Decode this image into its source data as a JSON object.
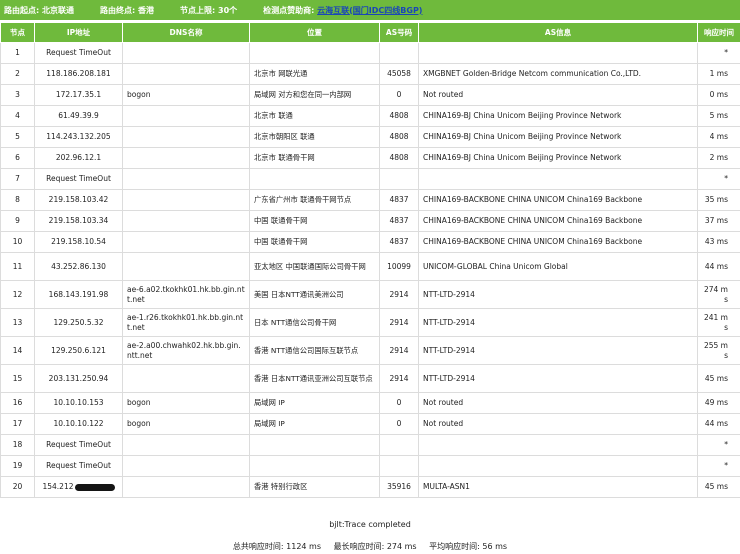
{
  "header": {
    "start_label": "路由起点:",
    "start_value": "北京联通",
    "end_label": "路由终点:",
    "end_value": "香港",
    "hop_limit_label": "节点上限:",
    "hop_limit_value": "30个",
    "sponsor_label": "检测点赞助商:",
    "sponsor_name": "云海互联",
    "sponsor_link": "(国门IDC四线BGP)"
  },
  "columns": [
    "节点",
    "IP地址",
    "DNS名称",
    "位置",
    "AS号码",
    "AS信息",
    "响应时间"
  ],
  "rows": [
    {
      "hop": "1",
      "ip": "Request TimeOut",
      "dns": "",
      "loc": "",
      "asn": "",
      "asinfo": "",
      "time": "*"
    },
    {
      "hop": "2",
      "ip": "118.186.208.181",
      "dns": "",
      "loc": "北京市 网联光通",
      "asn": "45058",
      "asinfo": "XMGBNET Golden-Bridge Netcom communication Co.,LTD.",
      "time": "1 ms"
    },
    {
      "hop": "3",
      "ip": "172.17.35.1",
      "dns": "bogon",
      "loc": "局域网 对方和您在同一内部网",
      "asn": "0",
      "asinfo": "Not routed",
      "time": "0 ms"
    },
    {
      "hop": "4",
      "ip": "61.49.39.9",
      "dns": "",
      "loc": "北京市 联通",
      "asn": "4808",
      "asinfo": "CHINA169-BJ China Unicom Beijing Province Network",
      "time": "5 ms"
    },
    {
      "hop": "5",
      "ip": "114.243.132.205",
      "dns": "",
      "loc": "北京市朝阳区 联通",
      "asn": "4808",
      "asinfo": "CHINA169-BJ China Unicom Beijing Province Network",
      "time": "4 ms"
    },
    {
      "hop": "6",
      "ip": "202.96.12.1",
      "dns": "",
      "loc": "北京市 联通骨干网",
      "asn": "4808",
      "asinfo": "CHINA169-BJ China Unicom Beijing Province Network",
      "time": "2 ms"
    },
    {
      "hop": "7",
      "ip": "Request TimeOut",
      "dns": "",
      "loc": "",
      "asn": "",
      "asinfo": "",
      "time": "*"
    },
    {
      "hop": "8",
      "ip": "219.158.103.42",
      "dns": "",
      "loc": "广东省广州市 联通骨干网节点",
      "asn": "4837",
      "asinfo": "CHINA169-BACKBONE CHINA UNICOM China169 Backbone",
      "time": "35 ms"
    },
    {
      "hop": "9",
      "ip": "219.158.103.34",
      "dns": "",
      "loc": "中国 联通骨干网",
      "asn": "4837",
      "asinfo": "CHINA169-BACKBONE CHINA UNICOM China169 Backbone",
      "time": "37 ms"
    },
    {
      "hop": "10",
      "ip": "219.158.10.54",
      "dns": "",
      "loc": "中国 联通骨干网",
      "asn": "4837",
      "asinfo": "CHINA169-BACKBONE CHINA UNICOM China169 Backbone",
      "time": "43 ms"
    },
    {
      "hop": "11",
      "ip": "43.252.86.130",
      "dns": "",
      "loc": "亚太地区 中国联通国际公司骨干网",
      "asn": "10099",
      "asinfo": "UNICOM-GLOBAL China Unicom Global",
      "time": "44 ms"
    },
    {
      "hop": "12",
      "ip": "168.143.191.98",
      "dns": "ae-6.a02.tkokhk01.hk.bb.gin.ntt.net",
      "loc": "美国 日本NTT通讯美洲公司",
      "asn": "2914",
      "asinfo": "NTT-LTD-2914",
      "time": "274 ms"
    },
    {
      "hop": "13",
      "ip": "129.250.5.32",
      "dns": "ae-1.r26.tkokhk01.hk.bb.gin.ntt.net",
      "loc": "日本 NTT通信公司骨干网",
      "asn": "2914",
      "asinfo": "NTT-LTD-2914",
      "time": "241 ms"
    },
    {
      "hop": "14",
      "ip": "129.250.6.121",
      "dns": "ae-2.a00.chwahk02.hk.bb.gin.ntt.net",
      "loc": "香港 NTT通信公司国际互联节点",
      "asn": "2914",
      "asinfo": "NTT-LTD-2914",
      "time": "255 ms"
    },
    {
      "hop": "15",
      "ip": "203.131.250.94",
      "dns": "",
      "loc": "香港 日本NTT通讯亚洲公司互联节点",
      "asn": "2914",
      "asinfo": "NTT-LTD-2914",
      "time": "45 ms"
    },
    {
      "hop": "16",
      "ip": "10.10.10.153",
      "dns": "bogon",
      "loc": "局域网 IP",
      "asn": "0",
      "asinfo": "Not routed",
      "time": "49 ms"
    },
    {
      "hop": "17",
      "ip": "10.10.10.122",
      "dns": "bogon",
      "loc": "局域网 IP",
      "asn": "0",
      "asinfo": "Not routed",
      "time": "44 ms"
    },
    {
      "hop": "18",
      "ip": "Request TimeOut",
      "dns": "",
      "loc": "",
      "asn": "",
      "asinfo": "",
      "time": "*"
    },
    {
      "hop": "19",
      "ip": "Request TimeOut",
      "dns": "",
      "loc": "",
      "asn": "",
      "asinfo": "",
      "time": "*"
    },
    {
      "hop": "20",
      "ip": "154.212",
      "dns": "",
      "loc": "香港 特别行政区",
      "asn": "35916",
      "asinfo": "MULTA-ASN1",
      "time": "45 ms"
    }
  ],
  "footer": {
    "status": "bjlt:Trace completed",
    "total_label": "总共响应时间:",
    "total_value": "1124 ms",
    "max_label": "最长响应时间:",
    "max_value": "274 ms",
    "avg_label": "平均响应时间:",
    "avg_value": "56 ms"
  }
}
